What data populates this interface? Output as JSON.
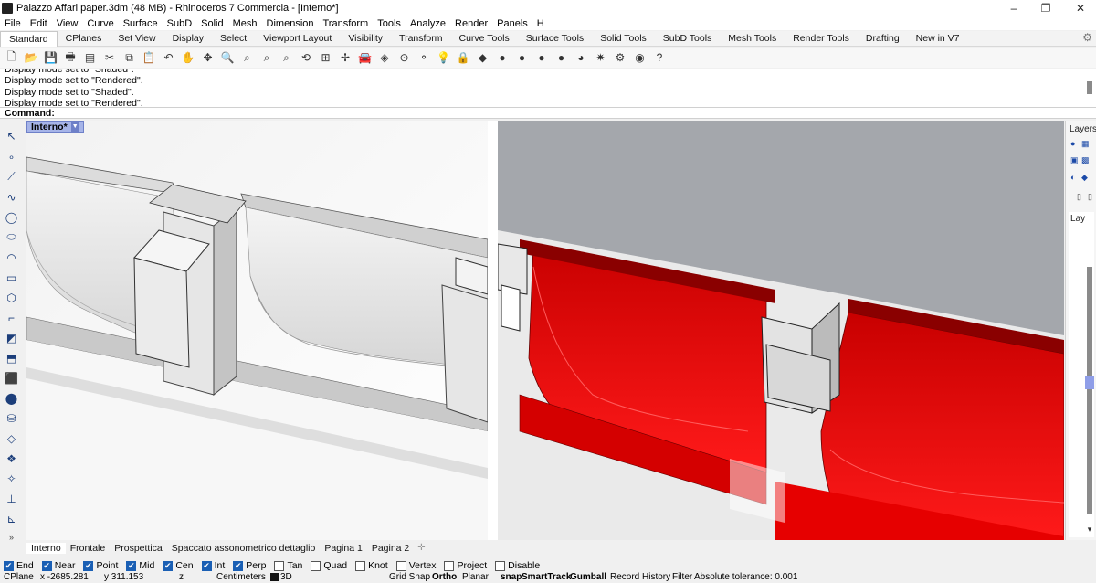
{
  "window": {
    "title": "Palazzo Affari paper.3dm (48 MB) - Rhinoceros 7 Commercia - [Interno*]"
  },
  "menu": [
    "File",
    "Edit",
    "View",
    "Curve",
    "Surface",
    "SubD",
    "Solid",
    "Mesh",
    "Dimension",
    "Transform",
    "Tools",
    "Analyze",
    "Render",
    "Panels",
    "H"
  ],
  "toolbar_tabs": [
    "Standard",
    "CPlanes",
    "Set View",
    "Display",
    "Select",
    "Viewport Layout",
    "Visibility",
    "Transform",
    "Curve Tools",
    "Surface Tools",
    "Solid Tools",
    "SubD Tools",
    "Mesh Tools",
    "Render Tools",
    "Drafting",
    "New in V7"
  ],
  "command_history": [
    "Display mode set to \"Shaded\".",
    "Display mode set to \"Rendered\".",
    "Display mode set to \"Shaded\".",
    "Display mode set to \"Rendered\"."
  ],
  "command_prompt": "Command:",
  "viewport": {
    "title": "Interno*",
    "colors": {
      "background": "#a4a7ac",
      "highlight": "#e00000"
    }
  },
  "right_panel": {
    "tab_label": "Layers",
    "list_label": "Lay"
  },
  "viewport_tabs": [
    "Interno",
    "Frontale",
    "Prospettica",
    "Spaccato assonometrico dettaglio",
    "Pagina 1",
    "Pagina 2"
  ],
  "osnaps": [
    {
      "label": "End",
      "checked": true
    },
    {
      "label": "Near",
      "checked": true
    },
    {
      "label": "Point",
      "checked": true
    },
    {
      "label": "Mid",
      "checked": true
    },
    {
      "label": "Cen",
      "checked": true
    },
    {
      "label": "Int",
      "checked": true
    },
    {
      "label": "Perp",
      "checked": true
    },
    {
      "label": "Tan",
      "checked": false
    },
    {
      "label": "Quad",
      "checked": false
    },
    {
      "label": "Knot",
      "checked": false
    },
    {
      "label": "Vertex",
      "checked": false
    },
    {
      "label": "Project",
      "checked": false
    },
    {
      "label": "Disable",
      "checked": false
    }
  ],
  "status": {
    "cplane": "CPlane",
    "x": "x -2685.281",
    "y": "y 311.153",
    "z": "z",
    "units": "Centimeters",
    "layer": "3D",
    "grid_snap": "Grid Snap",
    "ortho": "Ortho",
    "planar": "Planar",
    "osnap": "snap",
    "smarttrack": "SmartTrack",
    "gumball": "Gumball",
    "record_history": "Record History",
    "filter": "Filter",
    "tolerance": "Absolute tolerance: 0.001"
  }
}
